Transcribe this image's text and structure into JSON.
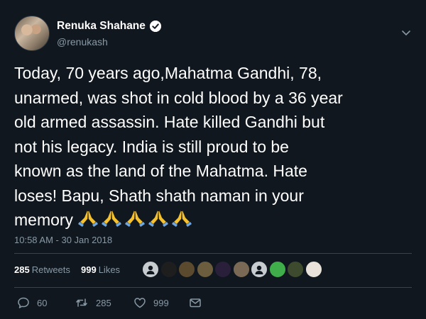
{
  "tweet": {
    "author": {
      "display_name": "Renuka Shahane",
      "handle": "@renukash",
      "verified": true,
      "avatar_icon": "user-avatar"
    },
    "text_lines": [
      "Today, 70 years ago,Mahatma Gandhi, 78,",
      "unarmed, was shot in cold blood by a 36 year",
      "old armed assassin. Hate killed Gandhi but",
      "not his legacy.  India is still proud to be",
      "known as the land of the Mahatma. Hate",
      "loses! Bapu, Shath shath naman in your",
      "memory"
    ],
    "emoji": [
      "folded-hands",
      "folded-hands",
      "folded-hands",
      "folded-hands",
      "folded-hands"
    ],
    "timestamp": "10:58 AM - 30 Jan 2018",
    "stats": {
      "retweets_count": "285",
      "retweets_label": "Retweets",
      "likes_count": "999",
      "likes_label": "Likes"
    },
    "likers_count": 10,
    "actions": {
      "reply_count": "60",
      "retweet_count": "285",
      "like_count": "999"
    }
  },
  "colors": {
    "background": "#10171e",
    "text_primary": "#ffffff",
    "text_secondary": "#8899a6",
    "divider": "#38444d",
    "emoji_yellow": "#f6c12e",
    "emoji_cuff": "#6fa7e0"
  }
}
